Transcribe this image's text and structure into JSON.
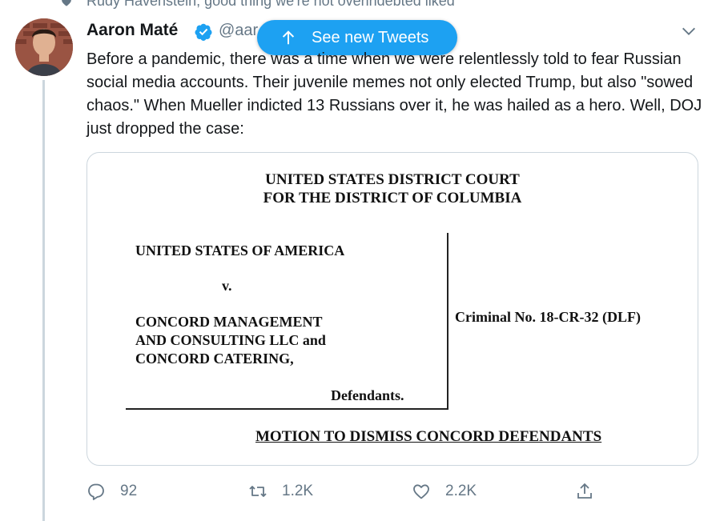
{
  "context": {
    "text": "Rudy Havenstein, good thing we're not overindebted liked"
  },
  "tweet": {
    "author_name": "Aaron Maté",
    "handle": "@aar",
    "text": "Before a pandemic, there was a time when we were relentlessly told to fear Russian social media accounts. Their juvenile memes not only elected Trump, but also \"sowed chaos.\" When Mueller indicted 13 Russians over it, he was hailed as a hero. Well, DOJ just dropped the case:",
    "reply_count": "92",
    "retweet_count": "1.2K",
    "like_count": "2.2K"
  },
  "banner": {
    "label": "See new Tweets"
  },
  "document": {
    "court_line1": "UNITED STATES DISTRICT COURT",
    "court_line2": "FOR THE DISTRICT OF COLUMBIA",
    "plaintiff": "UNITED STATES OF AMERICA",
    "versus": "v.",
    "defendant_line1": "CONCORD MANAGEMENT",
    "defendant_line2": "AND CONSULTING LLC and",
    "defendant_line3": "CONCORD CATERING,",
    "defendants_label": "Defendants.",
    "case_number": "Criminal No. 18-CR-32 (DLF)",
    "motion_title": "MOTION TO DISMISS CONCORD DEFENDANTS"
  },
  "colors": {
    "accent": "#1da1f2",
    "muted_text": "#657786",
    "border": "#ccd6dd"
  },
  "icons": {
    "context": "heart-icon",
    "verified": "verified-badge-icon",
    "menu": "chevron-down-icon",
    "banner": "arrow-up-icon",
    "reply": "reply-icon",
    "retweet": "retweet-icon",
    "like": "heart-icon",
    "share": "share-icon"
  }
}
